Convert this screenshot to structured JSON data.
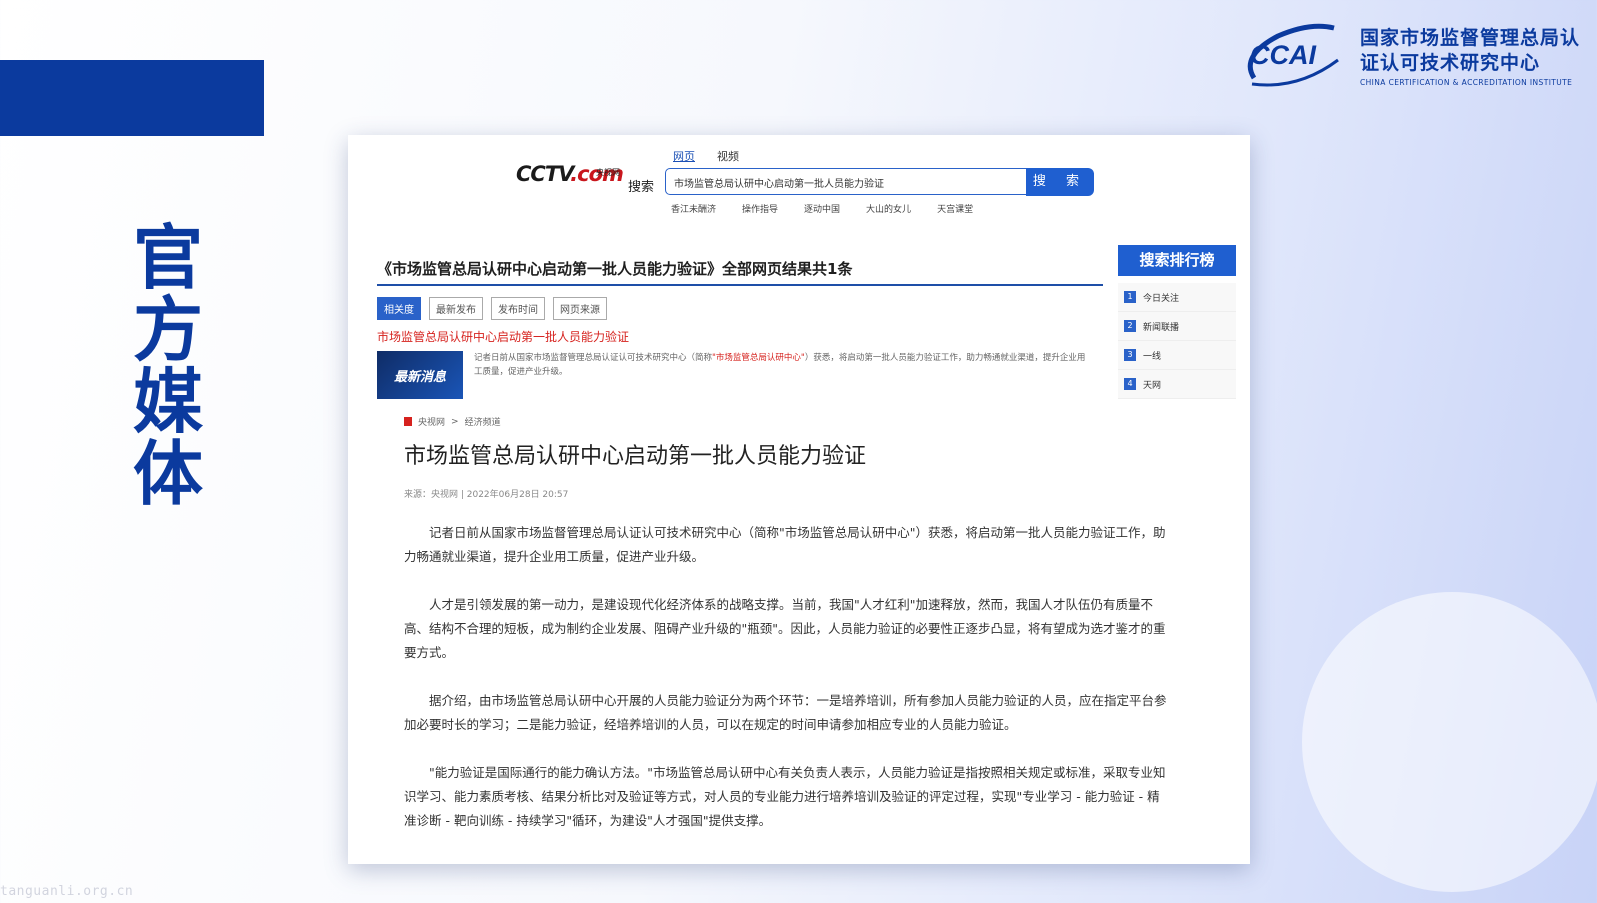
{
  "slide": {
    "section_title": "官方媒体",
    "org_name": "国家市场监督管理总局认证认可技术研究中心",
    "org_name_en": "CHINA CERTIFICATION & ACCREDITATION INSTITUTE",
    "logo_text": "CCAI",
    "watermark": "tanguanli.org.cn"
  },
  "search_page": {
    "tabs": [
      "网页",
      "视频"
    ],
    "site_logo": "CCTV",
    "site_logo_suffix": ".com",
    "site_logo_small": "央视网",
    "search_word": "搜索",
    "query": "市场监管总局认研中心启动第一批人员能力验证",
    "search_button": "搜 索",
    "hot_links": [
      "香江未酬济",
      "操作指导",
      "逐动中国",
      "大山的女儿",
      "天宫课堂"
    ],
    "result_header": "《市场监管总局认研中心启动第一批人员能力验证》全部网页结果共1条",
    "sort_options": [
      "相关度",
      "最新发布",
      "发布时间",
      "网页来源"
    ],
    "result_link": "市场监管总局认研中心启动第一批人员能力验证",
    "thumb_text": "最新消息",
    "snippet_pre": "记者日前从国家市场监督管理总局认证认可技术研究中心（简称",
    "snippet_hl": "\"市场监管总局认研中心\"",
    "snippet_post": "）获悉，将启动第一批人员能力验证工作，助力畅通就业渠道，提升企业用工质量，促进产业升级。",
    "ranking_title": "搜索排行榜",
    "ranking": [
      {
        "num": "1",
        "label": "今日关注"
      },
      {
        "num": "2",
        "label": "新闻联播"
      },
      {
        "num": "3",
        "label": "一线"
      },
      {
        "num": "4",
        "label": "天网"
      }
    ]
  },
  "article": {
    "breadcrumb_site": "央视网",
    "breadcrumb_sep": ">",
    "breadcrumb_channel": "经济频道",
    "title": "市场监管总局认研中心启动第一批人员能力验证",
    "meta": "来源：央视网 | 2022年06月28日 20:57",
    "paragraphs": [
      "记者日前从国家市场监督管理总局认证认可技术研究中心（简称\"市场监管总局认研中心\"）获悉，将启动第一批人员能力验证工作，助力畅通就业渠道，提升企业用工质量，促进产业升级。",
      "人才是引领发展的第一动力，是建设现代化经济体系的战略支撑。当前，我国\"人才红利\"加速释放，然而，我国人才队伍仍有质量不高、结构不合理的短板，成为制约企业发展、阻碍产业升级的\"瓶颈\"。因此，人员能力验证的必要性正逐步凸显，将有望成为选才鉴才的重要方式。",
      "据介绍，由市场监管总局认研中心开展的人员能力验证分为两个环节：一是培养培训，所有参加人员能力验证的人员，应在指定平台参加必要时长的学习；二是能力验证，经培养培训的人员，可以在规定的时间申请参加相应专业的人员能力验证。",
      "\"能力验证是国际通行的能力确认方法。\"市场监管总局认研中心有关负责人表示，人员能力验证是指按照相关规定或标准，采取专业知识学习、能力素质考核、结果分析比对及验证等方式，对人员的专业能力进行培养培训及验证的评定过程，实现\"专业学习 - 能力验证 - 精准诊断 - 靶向训练 - 持续学习\"循环，为建设\"人才强国\"提供支撑。"
    ]
  },
  "colors": {
    "brand_blue": "#0b3a9e",
    "search_blue": "#1f5fd0",
    "highlight_red": "#d6221e"
  }
}
